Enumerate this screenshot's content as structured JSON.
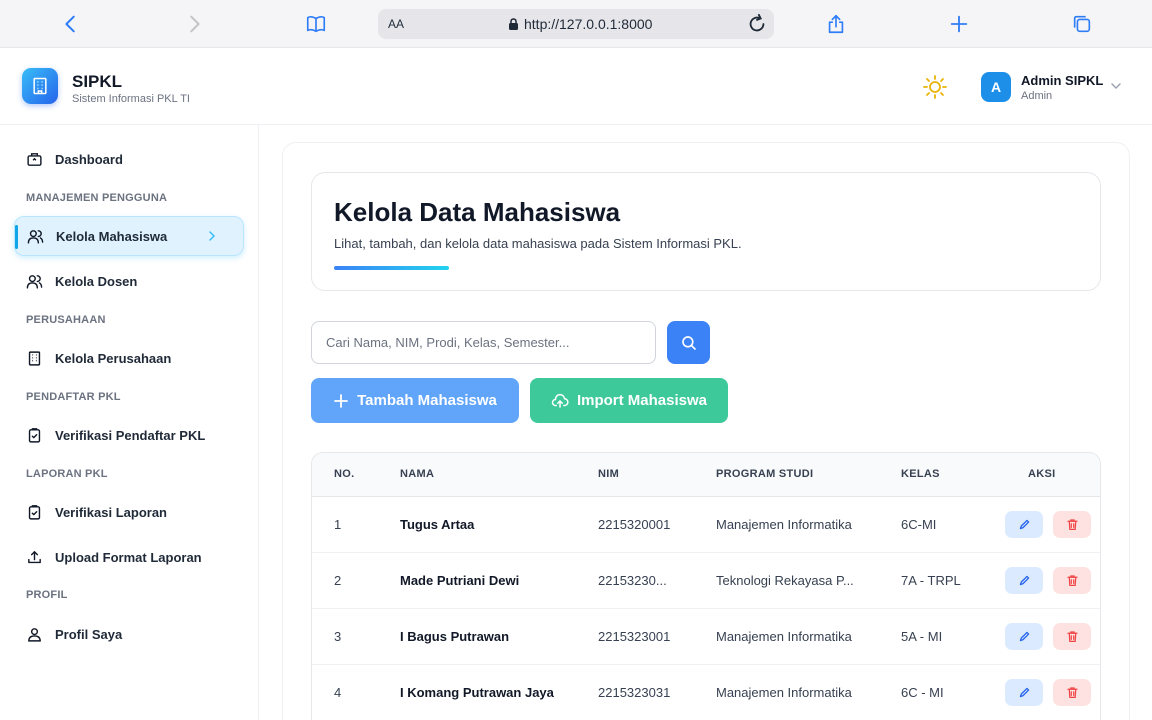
{
  "browser": {
    "url": "http://127.0.0.1:8000",
    "text_size_label": "AA"
  },
  "header": {
    "brand_name": "SIPKL",
    "brand_subtitle": "Sistem Informasi PKL TI",
    "user_initial": "A",
    "user_name": "Admin SIPKL",
    "user_role": "Admin"
  },
  "sidebar": {
    "dashboard": "Dashboard",
    "section_users": "MANAJEMEN PENGGUNA",
    "kelola_mahasiswa": "Kelola Mahasiswa",
    "kelola_dosen": "Kelola Dosen",
    "section_company": "PERUSAHAAN",
    "kelola_perusahaan": "Kelola Perusahaan",
    "section_registrant": "PENDAFTAR PKL",
    "verifikasi_pendaftar": "Verifikasi Pendaftar PKL",
    "section_report": "LAPORAN PKL",
    "verifikasi_laporan": "Verifikasi Laporan",
    "upload_format": "Upload Format Laporan",
    "section_profile": "PROFIL",
    "profil_saya": "Profil Saya"
  },
  "main": {
    "title": "Kelola Data Mahasiswa",
    "description": "Lihat, tambah, dan kelola data mahasiswa pada Sistem Informasi PKL.",
    "search_placeholder": "Cari Nama, NIM, Prodi, Kelas, Semester...",
    "add_button": "Tambah Mahasiswa",
    "import_button": "Import Mahasiswa"
  },
  "table": {
    "headers": {
      "no": "NO.",
      "nama": "NAMA",
      "nim": "NIM",
      "prodi": "PROGRAM STUDI",
      "kelas": "KELAS",
      "aksi": "AKSI"
    },
    "rows": [
      {
        "no": "1",
        "nama": "Tugus Artaa",
        "nim": "2215320001",
        "prodi": "Manajemen Informatika",
        "kelas": "6C-MI"
      },
      {
        "no": "2",
        "nama": "Made Putriani Dewi",
        "nim": "22153230...",
        "prodi": "Teknologi Rekayasa P...",
        "kelas": "7A - TRPL"
      },
      {
        "no": "3",
        "nama": "I Bagus Putrawan",
        "nim": "2215323001",
        "prodi": "Manajemen Informatika",
        "kelas": "5A - MI"
      },
      {
        "no": "4",
        "nama": "I Komang Putrawan Jaya",
        "nim": "2215323031",
        "prodi": "Manajemen Informatika",
        "kelas": "6C - MI"
      }
    ]
  },
  "colors": {
    "accent": "#3b82f6",
    "import_green": "#3ec99a",
    "active_nav_bg": "#e0f2fe",
    "edit_bg": "#dbeafe",
    "delete_bg": "#fee2e2"
  }
}
